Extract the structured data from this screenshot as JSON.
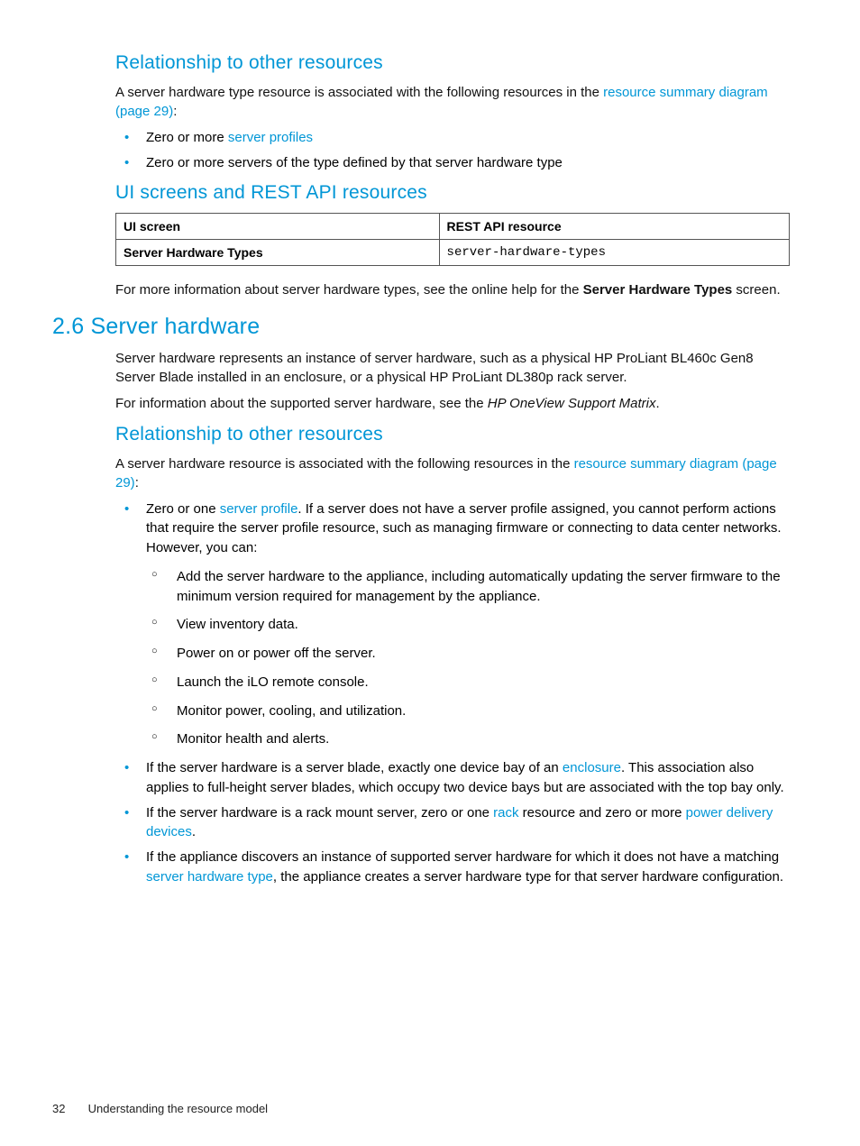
{
  "section1": {
    "heading": "Relationship to other resources",
    "p1_a": "A server hardware type resource is associated with the following resources in the ",
    "p1_link": "resource summary diagram (page 29)",
    "p1_b": ":",
    "bullets": {
      "b1_a": "Zero or more ",
      "b1_link": "server profiles",
      "b2": "Zero or more servers of the type defined by that server hardware type"
    }
  },
  "section2": {
    "heading": "UI screens and REST API resources",
    "table": {
      "th1": "UI screen",
      "th2": "REST API resource",
      "td1": "Server Hardware Types",
      "td2": "server-hardware-types"
    },
    "p_a": "For more information about server hardware types, see the online help for the ",
    "p_bold": "Server Hardware Types",
    "p_b": " screen."
  },
  "section3": {
    "heading": "2.6 Server hardware",
    "p1": "Server hardware represents an instance of server hardware, such as a physical HP ProLiant BL460c Gen8 Server Blade installed in an enclosure, or a physical HP ProLiant DL380p rack server.",
    "p2_a": "For information about the supported server hardware, see the ",
    "p2_italic": "HP OneView Support Matrix",
    "p2_b": "."
  },
  "section4": {
    "heading": "Relationship to other resources",
    "p1_a": "A server hardware resource is associated with the following resources in the ",
    "p1_link": "resource summary diagram (page 29)",
    "p1_b": ":",
    "b1_a": "Zero or one ",
    "b1_link": "server profile",
    "b1_b": ". If a server does not have a server profile assigned, you cannot perform actions that require the server profile resource, such as managing firmware or connecting to data center networks. However, you can:",
    "sub": {
      "s1": "Add the server hardware to the appliance, including automatically updating the server firmware to the minimum version required for management by the appliance.",
      "s2": "View inventory data.",
      "s3": "Power on or power off the server.",
      "s4": "Launch the iLO remote console.",
      "s5": "Monitor power, cooling, and utilization.",
      "s6": "Monitor health and alerts."
    },
    "b2_a": "If the server hardware is a server blade, exactly one device bay of an ",
    "b2_link": "enclosure",
    "b2_b": ". This association also applies to full-height server blades, which occupy two device bays but are associated with the top bay only.",
    "b3_a": "If the server hardware is a rack mount server, zero or one ",
    "b3_link1": "rack",
    "b3_b": " resource and zero or more ",
    "b3_link2": "power delivery devices",
    "b3_c": ".",
    "b4_a": "If the appliance discovers an instance of supported server hardware for which it does not have a matching ",
    "b4_link": "server hardware type",
    "b4_b": ", the appliance creates a server hardware type for that server hardware configuration."
  },
  "footer": {
    "page": "32",
    "title": "Understanding the resource model"
  }
}
